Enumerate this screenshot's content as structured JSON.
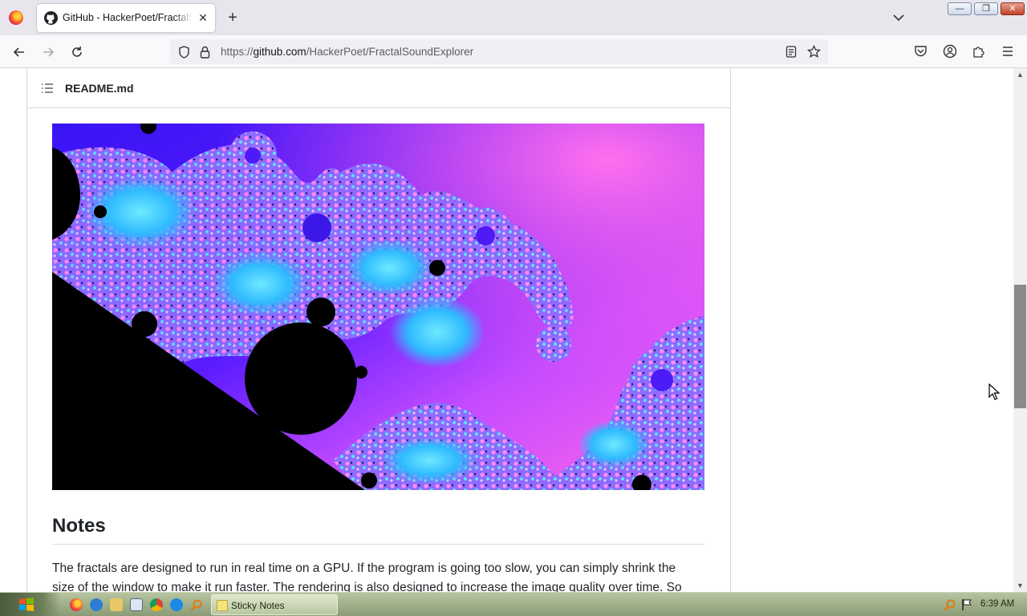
{
  "browser": {
    "tab_title": "GitHub - HackerPoet/FractalSoundExplorer",
    "tab_close_glyph": "✕",
    "new_tab_glyph": "+",
    "url_scheme": "https://",
    "url_host": "github.com",
    "url_path": "/HackerPoet/FractalSoundExplorer",
    "window_buttons": {
      "minimize": "—",
      "maximize": "❐",
      "close": "✕"
    }
  },
  "readme": {
    "header_title": "README.md",
    "image_description_colors": [
      "#000000",
      "#ff5cf0",
      "#4a1bff",
      "#3ad6ff",
      "#a94bff"
    ],
    "notes_heading": "Notes",
    "notes_paragraph_line1": "The fractals are designed to run in real time on a GPU. If the program is going too slow, you can simply shrink the",
    "notes_paragraph_line2": "size of the window to make it run faster. The rendering is also designed to increase the image quality over time. So"
  },
  "scrollbar": {
    "up_glyph": "▲",
    "down_glyph": "▼",
    "position_fraction": 0.46
  },
  "taskbar": {
    "task_label": "Sticky Notes",
    "clock": "6:39 AM"
  },
  "icons": [
    "firefox-icon",
    "github-icon",
    "back-icon",
    "forward-icon",
    "reload-icon",
    "shield-icon",
    "lock-icon",
    "reader-icon",
    "bookmark-star-icon",
    "pocket-icon",
    "account-icon",
    "extensions-icon",
    "menu-icon",
    "toc-icon",
    "windows-start-icon",
    "sticky-notes-icon",
    "search-icon",
    "flag-icon"
  ]
}
